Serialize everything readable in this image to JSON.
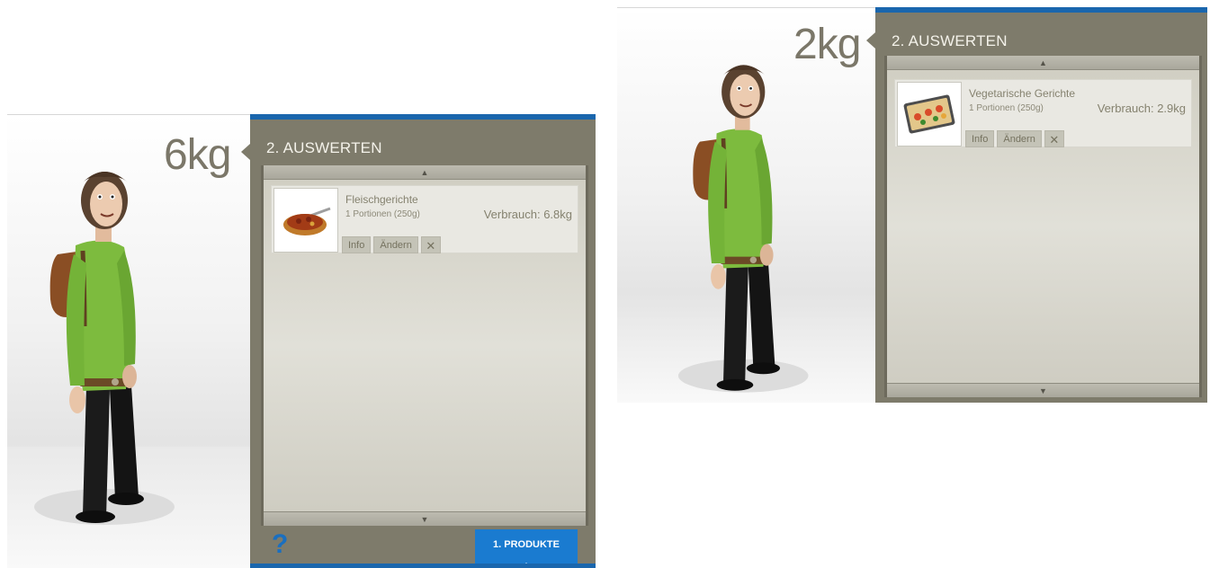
{
  "left": {
    "weight": "6kg",
    "section_title": "2. AUSWERTEN",
    "item": {
      "name": "Fleischgerichte",
      "portion": "1 Portionen (250g)",
      "usage": "Verbrauch: 6.8kg",
      "thumb_icon": "meat-dish-icon"
    },
    "actions": {
      "info": "Info",
      "change": "Ändern",
      "remove": "✕"
    },
    "help": "?",
    "tab_products": "1. PRODUKTE"
  },
  "right": {
    "weight": "2kg",
    "section_title": "2. AUSWERTEN",
    "item": {
      "name": "Vegetarische Gerichte",
      "portion": "1 Portionen (250g)",
      "usage": "Verbrauch: 2.9kg",
      "thumb_icon": "vegetable-tray-icon"
    },
    "actions": {
      "info": "Info",
      "change": "Ändern",
      "remove": "✕"
    }
  },
  "colors": {
    "panel": "#7e7b6b",
    "accent_blue": "#1a66ad",
    "tab_blue": "#1a7bd0",
    "weight_text": "#7b7769"
  }
}
